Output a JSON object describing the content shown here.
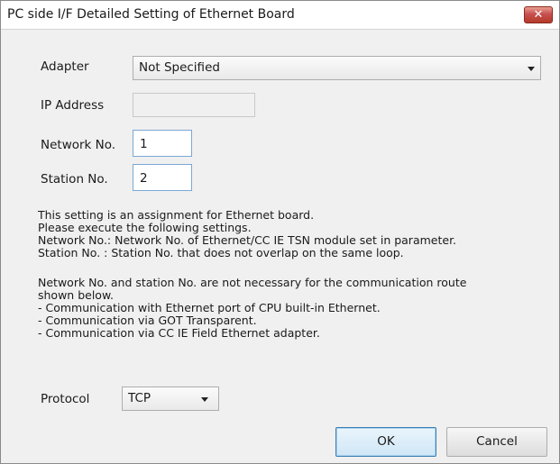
{
  "window": {
    "title": "PC side I/F Detailed Setting of Ethernet Board",
    "close_glyph": "✕"
  },
  "form": {
    "adapter_label": "Adapter",
    "adapter_value": "Not Specified",
    "ip_label": "IP Address",
    "ip_value": "",
    "network_label": "Network No.",
    "network_value": "1",
    "station_label": "Station No.",
    "station_value": "2",
    "protocol_label": "Protocol",
    "protocol_value": "TCP"
  },
  "description": {
    "lines": [
      "This setting is an assignment for Ethernet board.",
      "Please execute the following settings.",
      "Network No.: Network No. of Ethernet/CC IE TSN module set in parameter.",
      "Station No.  : Station No. that does not overlap on the same loop.",
      "Network No. and station No. are not necessary for the communication route",
      "shown below.",
      "- Communication with Ethernet port of CPU built-in Ethernet.",
      "- Communication via GOT Transparent.",
      "- Communication via CC IE Field Ethernet adapter."
    ]
  },
  "buttons": {
    "ok": "OK",
    "cancel": "Cancel"
  },
  "icons": {
    "close": "close-icon",
    "dropdown": "chevron-down-icon"
  }
}
